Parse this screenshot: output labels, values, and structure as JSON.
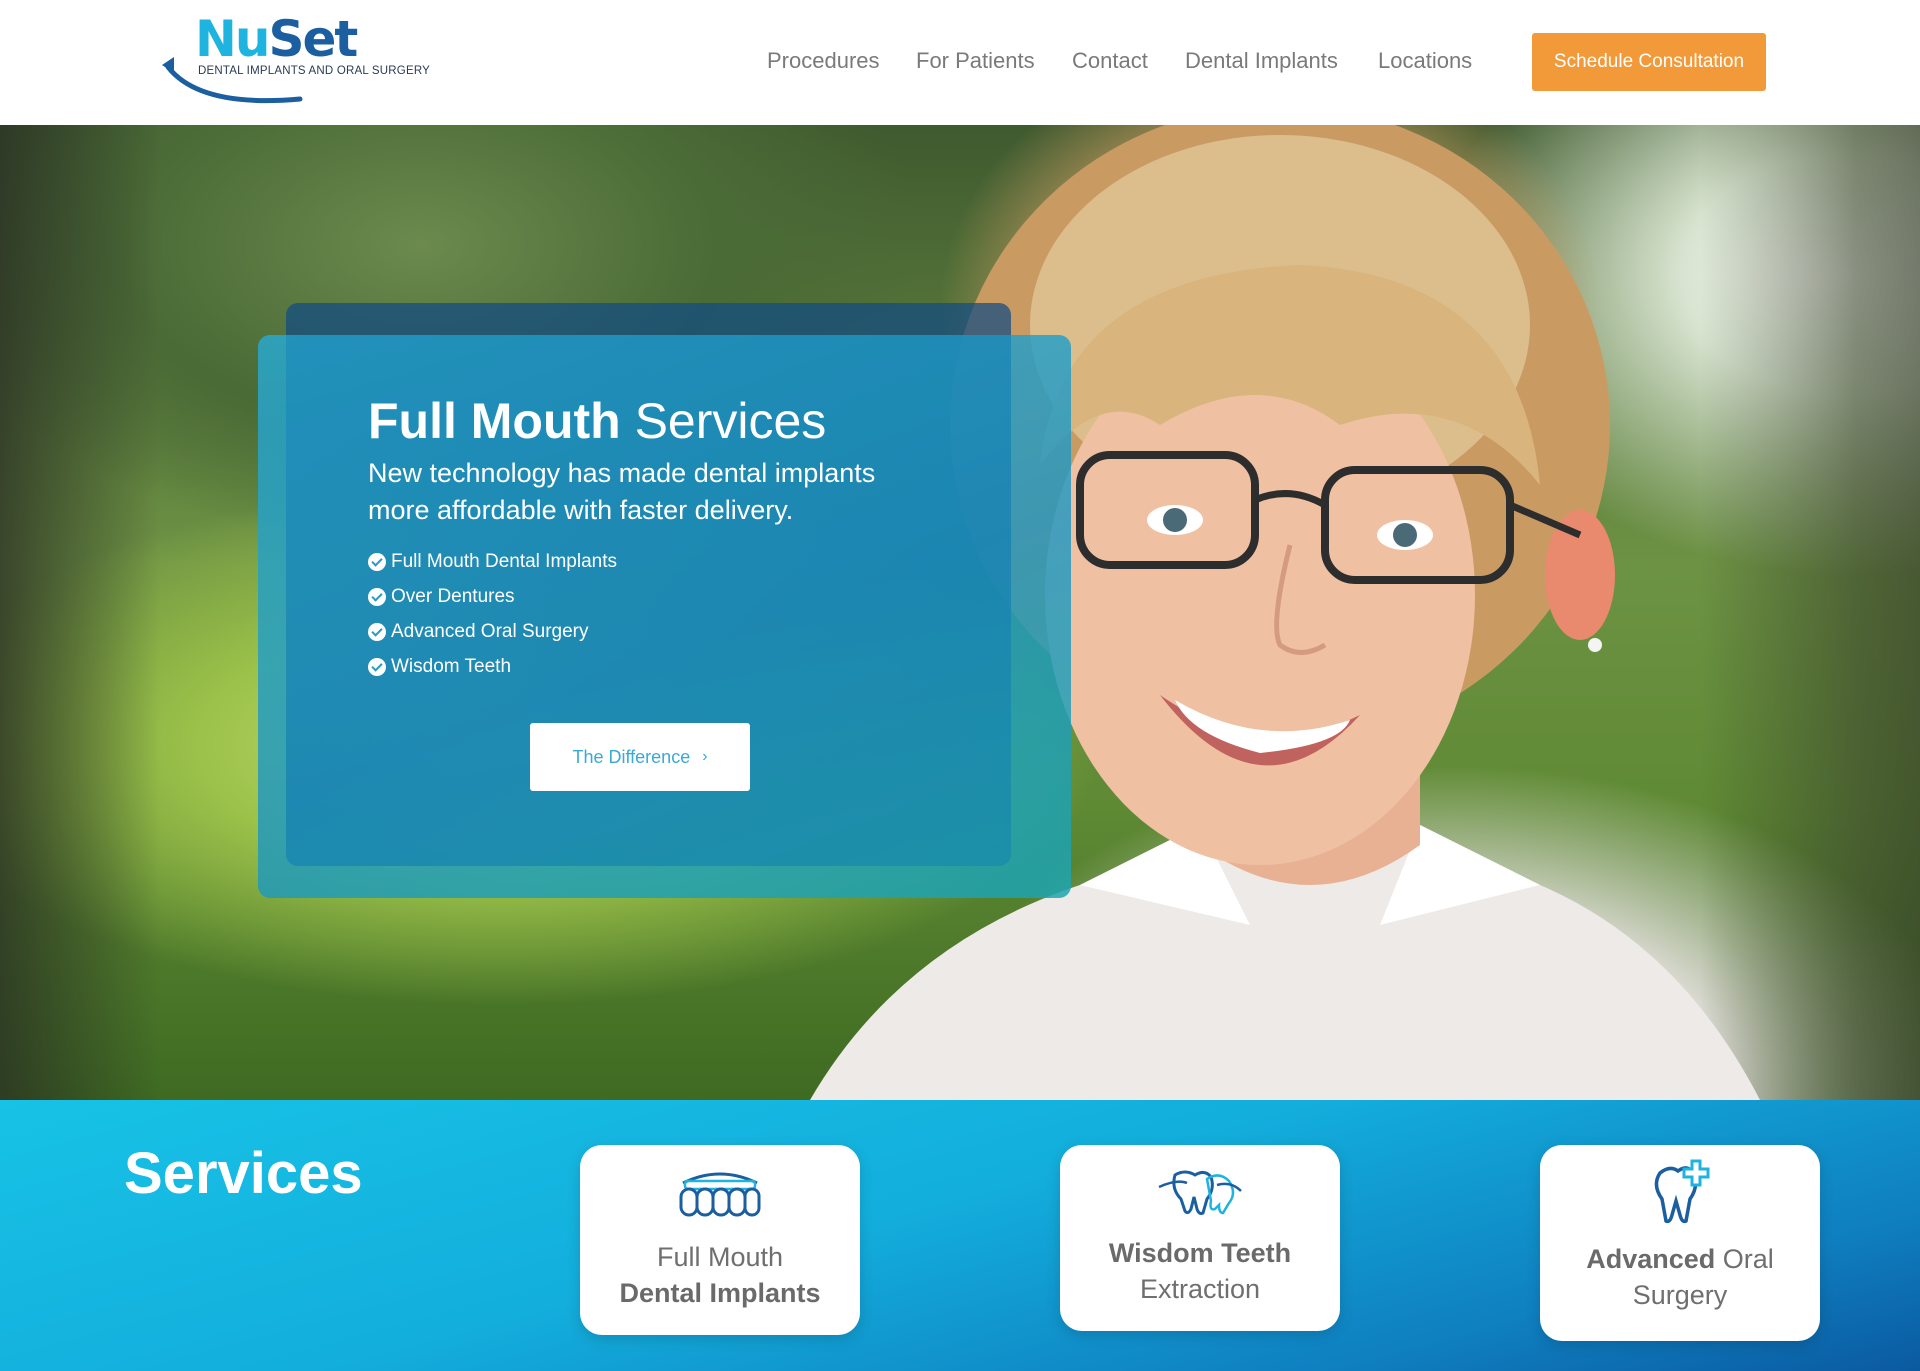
{
  "brand": {
    "name_part1": "Nu",
    "name_part2": "Set",
    "tagline": "DENTAL IMPLANTS AND ORAL SURGERY",
    "colors": {
      "primary": "#1fb3e0",
      "dark": "#1c5fa0",
      "accent": "#f29a3a"
    }
  },
  "nav": {
    "items": [
      {
        "label": "Procedures"
      },
      {
        "label": "For Patients"
      },
      {
        "label": "Contact"
      },
      {
        "label": "Dental Implants"
      },
      {
        "label": "Locations"
      }
    ],
    "cta_label": "Schedule Consultation"
  },
  "hero": {
    "title_bold": "Full Mouth",
    "title_light": " Services",
    "lead": "New technology has made dental implants more affordable with faster delivery.",
    "checklist": [
      "Full Mouth Dental Implants",
      "Over Dentures",
      "Advanced Oral Surgery",
      "Wisdom Teeth"
    ],
    "button_label": "The Difference",
    "button_icon": "chevron-right-icon"
  },
  "services": {
    "title": "Services",
    "cards": [
      {
        "line1": "Full Mouth",
        "line2": "Dental Implants",
        "icon": "dental-implant-bridge-icon"
      },
      {
        "line1": "Wisdom Teeth",
        "line2": "Extraction",
        "icon": "wisdom-teeth-icon"
      },
      {
        "line1_bold": "Advanced",
        "line1_rest": " Oral",
        "line2": "Surgery",
        "icon": "tooth-plus-icon"
      }
    ]
  }
}
